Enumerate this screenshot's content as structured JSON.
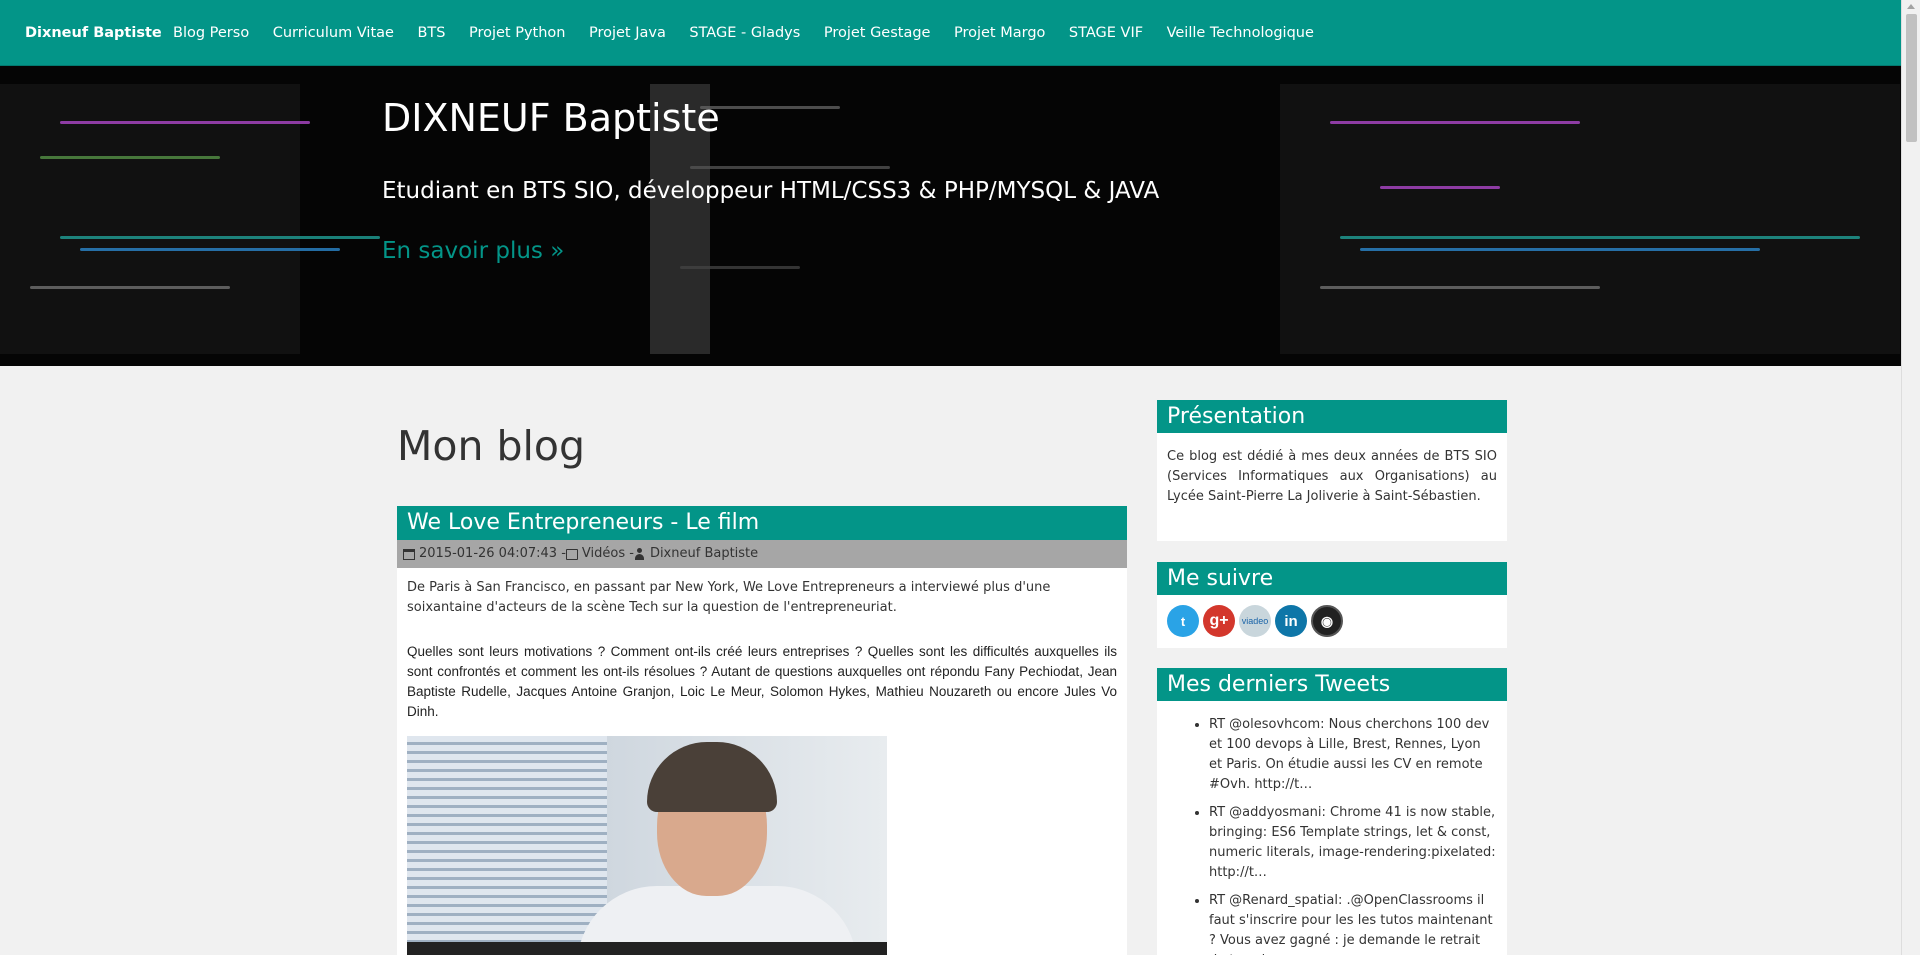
{
  "navbar": {
    "brand": "Dixneuf Baptiste",
    "items": [
      "Blog Perso",
      "Curriculum Vitae",
      "BTS",
      "Projet Python",
      "Projet Java",
      "STAGE - Gladys",
      "Projet Gestage",
      "Projet Margo",
      "STAGE VIF",
      "Veille Technologique"
    ]
  },
  "hero": {
    "title": "DIXNEUF Baptiste",
    "subtitle": "Etudiant en BTS SIO, développeur HTML/CSS3 & PHP/MYSQL & JAVA",
    "more": "En savoir plus »"
  },
  "main": {
    "title": "Mon blog",
    "post": {
      "title": "We Love Entrepreneurs - Le film",
      "date": "2015-01-26 04:07:43 - ",
      "category": "Vidéos - ",
      "author": "Dixneuf Baptiste",
      "intro": "De Paris à San Francisco, en passant par New York, We Love Entrepreneurs a interviewé plus d'une soixantaine d'acteurs de la scène Tech sur la question de l'entrepreneuriat.",
      "detail": "Quelles sont leurs motivations ? Comment ont-ils créé leurs entreprises ? Quelles sont les difficultés auxquelles ils sont confrontés et comment les ont-ils résolues ? Autant de questions auxquelles ont répondu Fany Pechiodat, Jean Baptiste Rudelle, Jacques Antoine Granjon, Loic Le Meur, Solomon Hykes, Mathieu Nouzareth ou encore Jules Vo Dinh."
    }
  },
  "sidebar": {
    "presentation": {
      "title": "Présentation",
      "text": "Ce blog est dédié à mes deux années de BTS SIO (Services Informatiques aux Organisations) au Lycée Saint-Pierre La Joliverie à Saint-Sébastien."
    },
    "follow": {
      "title": "Me suivre",
      "icons": [
        "twitter-icon",
        "google-plus-icon",
        "viadeo-icon",
        "linkedin-icon",
        "github-icon"
      ],
      "viadeo_text": "viadeo"
    },
    "tweets": {
      "title": "Mes derniers Tweets",
      "items": [
        "RT @olesovhcom: Nous cherchons 100 dev et 100 devops à Lille, Brest, Rennes, Lyon et Paris. On étudie aussi les CV en remote #Ovh. http://t…",
        "RT @addyosmani: Chrome 41 is now stable, bringing: ES6 Template strings, let & const, numeric literals, image-rendering:pixelated: http://t…",
        "RT @Renard_spatial: .@OpenClassrooms il faut s'inscrire pour les les tutos maintenant ? Vous avez gagné : je demande le retrait de tous les…"
      ]
    }
  },
  "colors": {
    "accent": "#039588",
    "meta_bar": "#a6a6a6",
    "background": "#f1f1f1"
  }
}
